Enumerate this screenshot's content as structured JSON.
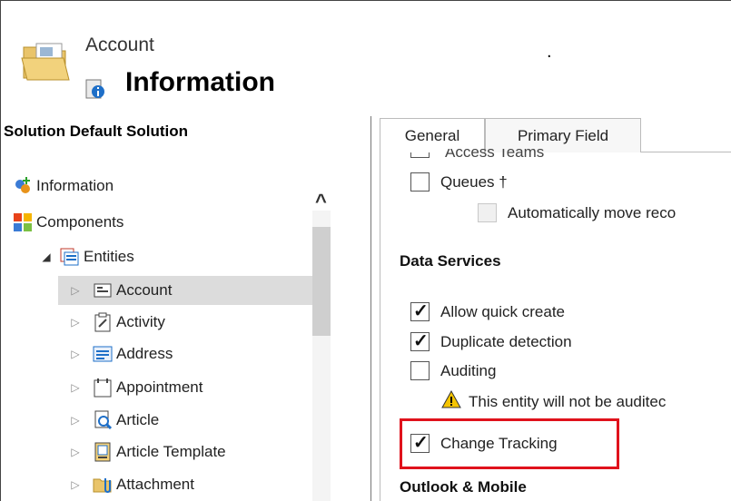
{
  "header": {
    "entity_label": "Account",
    "title": "Information",
    "dot": "."
  },
  "nav": {
    "solution_label": "Solution Default Solution",
    "items": [
      {
        "label": "Information",
        "icon": "information-icon"
      },
      {
        "label": "Components",
        "icon": "components-icon"
      },
      {
        "label": "Entities",
        "icon": "entities-icon"
      }
    ],
    "entities": [
      {
        "label": "Account",
        "icon": "account-entity-icon",
        "selected": true
      },
      {
        "label": "Activity",
        "icon": "activity-entity-icon"
      },
      {
        "label": "Address",
        "icon": "address-entity-icon"
      },
      {
        "label": "Appointment",
        "icon": "appointment-entity-icon"
      },
      {
        "label": "Article",
        "icon": "article-entity-icon"
      },
      {
        "label": "Article Template",
        "icon": "article-template-entity-icon"
      },
      {
        "label": "Attachment",
        "icon": "attachment-entity-icon"
      }
    ]
  },
  "tabs": [
    {
      "label": "General",
      "active": true
    },
    {
      "label": "Primary Field",
      "active": false
    }
  ],
  "form": {
    "cut_off_label": "Access Teams",
    "queues_label": "Queues †",
    "auto_move_label": "Automatically move reco",
    "data_services_title": "Data Services",
    "allow_quick_create": {
      "label": "Allow quick create",
      "checked": true
    },
    "duplicate_detection": {
      "label": "Duplicate detection",
      "checked": true
    },
    "auditing": {
      "label": "Auditing",
      "checked": false
    },
    "audit_warning": "This entity will not be auditec",
    "change_tracking": {
      "label": "Change Tracking",
      "checked": true
    },
    "outlook_title": "Outlook & Mobile"
  },
  "colors": {
    "highlight": "#e0121c",
    "selected_row": "#dcdcdc"
  }
}
